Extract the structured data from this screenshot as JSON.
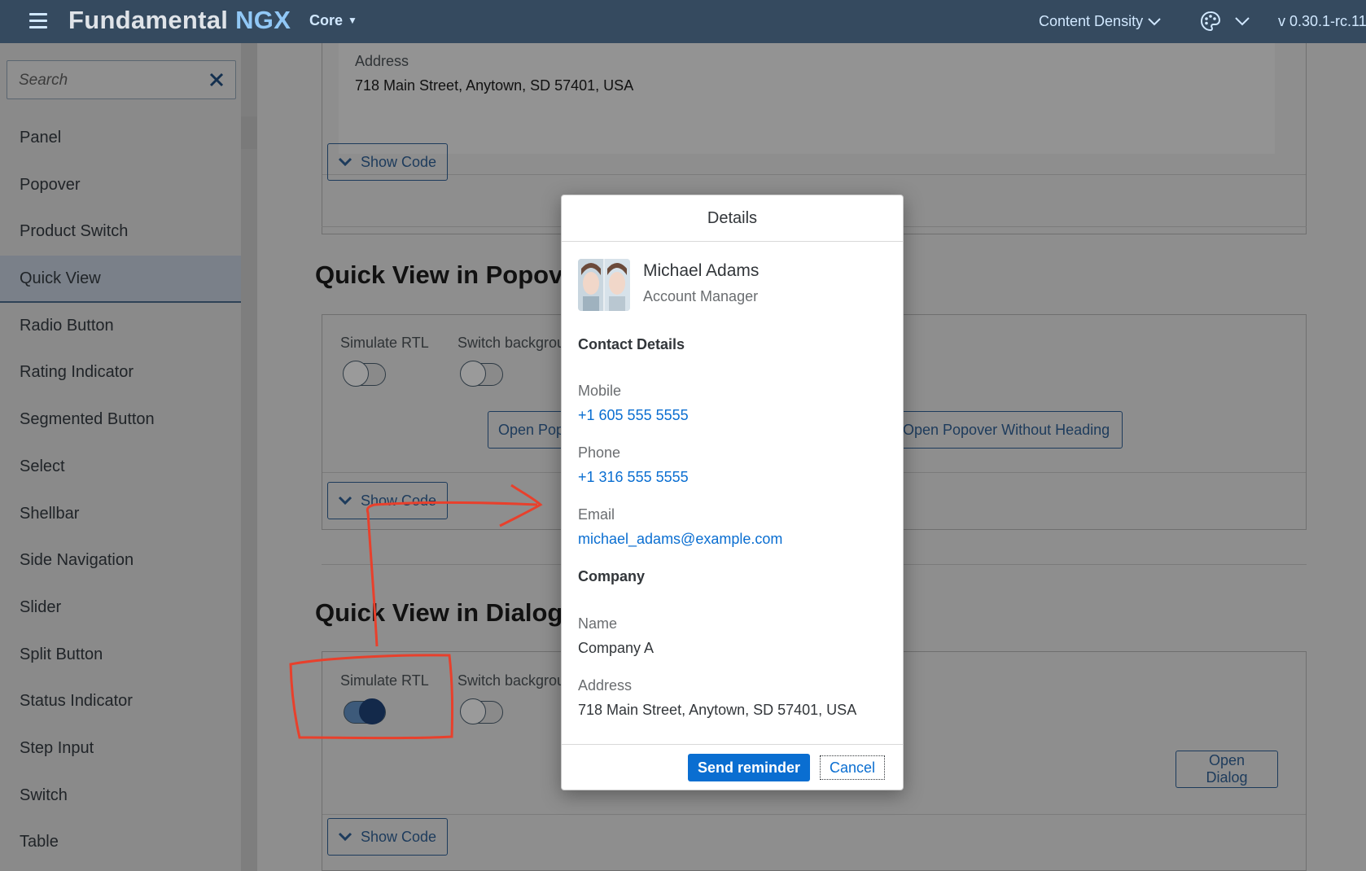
{
  "shellbar": {
    "brand_main": "Fundamental",
    "brand_accent": "NGX",
    "product": "Core",
    "content_density": "Content Density",
    "version": "v 0.30.1-rc.11"
  },
  "sidebar": {
    "search_placeholder": "Search",
    "items": [
      {
        "label": "Panel"
      },
      {
        "label": "Popover"
      },
      {
        "label": "Product Switch"
      },
      {
        "label": "Quick View",
        "active": true
      },
      {
        "label": "Radio Button"
      },
      {
        "label": "Rating Indicator"
      },
      {
        "label": "Segmented Button"
      },
      {
        "label": "Select"
      },
      {
        "label": "Shellbar"
      },
      {
        "label": "Side Navigation"
      },
      {
        "label": "Slider"
      },
      {
        "label": "Split Button"
      },
      {
        "label": "Status Indicator"
      },
      {
        "label": "Step Input"
      },
      {
        "label": "Switch"
      },
      {
        "label": "Table"
      }
    ]
  },
  "main": {
    "top_card": {
      "address_label": "Address",
      "address_value": "718 Main Street, Anytown, SD 57401, USA",
      "show_code": "Show Code"
    },
    "popover_section": {
      "title": "Quick View in Popov",
      "simulate_rtl": "Simulate RTL",
      "switch_bg": "Switch backgrou",
      "open_popover": "Open Pop",
      "open_popover_no_heading": "Open Popover Without Heading",
      "show_code": "Show Code"
    },
    "dialog_section": {
      "title": "Quick View in Dialog",
      "simulate_rtl": "Simulate RTL",
      "switch_bg": "Switch backgrou",
      "open_dialog": "Open Dialog",
      "show_code": "Show Code"
    }
  },
  "dialog": {
    "title": "Details",
    "person": {
      "name": "Michael Adams",
      "role": "Account Manager"
    },
    "contact": {
      "heading": "Contact Details",
      "mobile_label": "Mobile",
      "mobile_value": "+1 605 555 5555",
      "phone_label": "Phone",
      "phone_value": "+1 316 555 5555",
      "email_label": "Email",
      "email_value": "michael_adams@example.com"
    },
    "company": {
      "heading": "Company",
      "name_label": "Name",
      "name_value": "Company A",
      "address_label": "Address",
      "address_value": "718 Main Street, Anytown, SD 57401, USA"
    },
    "buttons": {
      "primary": "Send reminder",
      "cancel": "Cancel"
    }
  },
  "colors": {
    "shellbar": "#354a5f",
    "accent": "#0a6ed1",
    "annotation": "#e8402c",
    "dim_overlay": "#8e8e8e"
  }
}
